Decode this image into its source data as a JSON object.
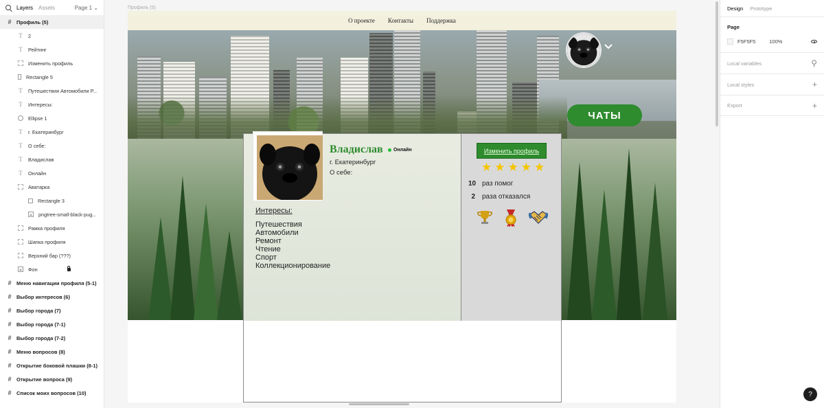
{
  "left_panel": {
    "tabs": {
      "layers": "Layers",
      "assets": "Assets"
    },
    "page_selector": "Page 1",
    "frame_title": "Профиль (5)",
    "layers": [
      {
        "label": "2",
        "icon": "text-icon",
        "indent": 1
      },
      {
        "label": "Рейтинг",
        "icon": "text-icon",
        "indent": 1
      },
      {
        "label": "Изменить профиль",
        "icon": "group-icon",
        "indent": 1
      },
      {
        "label": "Rectangle 5",
        "icon": "rectangle-icon",
        "indent": 1
      },
      {
        "label": "Путешествия Автомобили Р...",
        "icon": "text-icon",
        "indent": 1
      },
      {
        "label": "Интересы:",
        "icon": "text-icon",
        "indent": 1
      },
      {
        "label": "Ellipse 1",
        "icon": "ellipse-icon",
        "indent": 1
      },
      {
        "label": "г. Екатеринбург",
        "icon": "text-icon",
        "indent": 1
      },
      {
        "label": "О себе:",
        "icon": "text-icon",
        "indent": 1
      },
      {
        "label": "Владислав",
        "icon": "text-icon",
        "indent": 1
      },
      {
        "label": "Онлайн",
        "icon": "text-icon",
        "indent": 1
      },
      {
        "label": "Аватарка",
        "icon": "group-icon",
        "indent": 1
      },
      {
        "label": "Rectangle 3",
        "icon": "rectangle-icon",
        "indent": 2
      },
      {
        "label": "pngtree-small-black-pug...",
        "icon": "image-icon",
        "indent": 2
      },
      {
        "label": "Рамка профиля",
        "icon": "group-icon",
        "indent": 1
      },
      {
        "label": "Шапка профиля",
        "icon": "group-icon",
        "indent": 1
      },
      {
        "label": "Верхний бар (???)",
        "icon": "group-icon",
        "indent": 1
      },
      {
        "label": "Фон",
        "icon": "image-icon",
        "indent": 1,
        "locked": true
      }
    ],
    "frames": [
      "Меню навигации профиля (5-1)",
      "Выбор интересов (6)",
      "Выбор города (7)",
      "Выбор города (7-1)",
      "Выбор города (7-2)",
      "Меню вопросов (8)",
      "Открытие боковой плашки (8-1)",
      "Открытие вопроса (9)",
      "Список моих вопросов (10)"
    ]
  },
  "right_panel": {
    "tabs": {
      "design": "Design",
      "prototype": "Prototype"
    },
    "page_section": {
      "title": "Page",
      "fill_hex": "F5F5F5",
      "opacity": "100%"
    },
    "sections": [
      "Local variables",
      "Local styles",
      "Export"
    ],
    "help": "?"
  },
  "canvas": {
    "frame_label": "Профиль (5)",
    "nav": [
      "О проекте",
      "Контакты",
      "Поддержка"
    ],
    "chats_button": "ЧАТЫ",
    "profile": {
      "name": "Владислав",
      "status": "Онлайн",
      "city": "г. Екатеринбург",
      "about_label": "О себе:",
      "interests_title": "Интересы:",
      "interests": [
        "Путешествия",
        "Автомобили",
        "Ремонт",
        "Чтение",
        "Спорт",
        "Коллекционирование"
      ],
      "edit_button": "Изменить профиль",
      "rating_stars": 5,
      "stats": [
        {
          "value": "10",
          "label": "раз помог"
        },
        {
          "value": "2",
          "label": "раза отказался"
        }
      ],
      "badges": [
        "trophy-icon",
        "medal-icon",
        "handshake-icon"
      ]
    }
  },
  "colors": {
    "accent_green": "#2e8b2e",
    "online_dot": "#22c03a",
    "star": "#f5c400",
    "nav_bg": "#fffae4",
    "canvas_bg": "#f5f5f5"
  }
}
